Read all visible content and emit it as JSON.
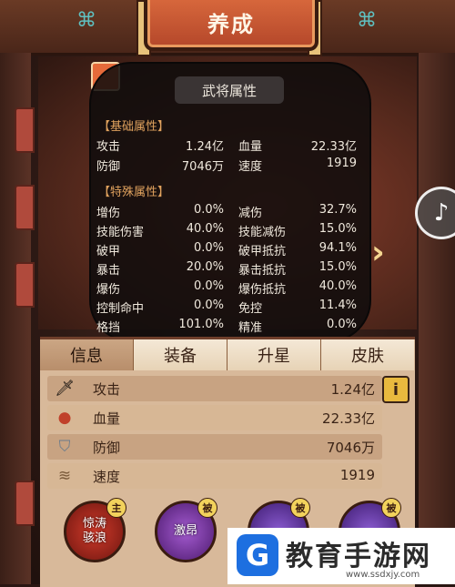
{
  "header": {
    "title": "养成"
  },
  "popup": {
    "title": "武将属性",
    "basic_title": "【基础属性】",
    "basic": [
      {
        "l1": "攻击",
        "v1": "1.24亿",
        "l2": "血量",
        "v2": "22.33亿"
      },
      {
        "l1": "防御",
        "v1": "7046万",
        "l2": "速度",
        "v2": "1919"
      }
    ],
    "special_title": "【特殊属性】",
    "special": [
      {
        "l1": "增伤",
        "v1": "0.0%",
        "l2": "减伤",
        "v2": "32.7%"
      },
      {
        "l1": "技能伤害",
        "v1": "40.0%",
        "l2": "技能减伤",
        "v2": "15.0%"
      },
      {
        "l1": "破甲",
        "v1": "0.0%",
        "l2": "破甲抵抗",
        "v2": "94.1%"
      },
      {
        "l1": "暴击",
        "v1": "20.0%",
        "l2": "暴击抵抗",
        "v2": "15.0%"
      },
      {
        "l1": "爆伤",
        "v1": "0.0%",
        "l2": "爆伤抵抗",
        "v2": "40.0%"
      },
      {
        "l1": "控制命中",
        "v1": "0.0%",
        "l2": "免控",
        "v2": "11.4%"
      },
      {
        "l1": "格挡",
        "v1": "101.0%",
        "l2": "精准",
        "v2": "0.0%"
      }
    ]
  },
  "tabs": [
    "信息",
    "装备",
    "升星",
    "皮肤"
  ],
  "stats": [
    {
      "icon": "sword-icon",
      "label": "攻击",
      "value": "1.24亿"
    },
    {
      "icon": "blood-drop-icon",
      "label": "血量",
      "value": "22.33亿"
    },
    {
      "icon": "shield-icon",
      "label": "防御",
      "value": "7046万"
    },
    {
      "icon": "boot-icon",
      "label": "速度",
      "value": "1919"
    }
  ],
  "info_button": "i",
  "skills": [
    {
      "name": "惊涛\n骇浪",
      "tag": "主"
    },
    {
      "name": "激昂",
      "tag": "被"
    },
    {
      "name": "",
      "tag": "被"
    },
    {
      "name": "",
      "tag": "被"
    }
  ],
  "watermark": {
    "text": "教育手游网",
    "url": "www.ssdxjy.com"
  },
  "colors": {
    "accent": "#c9572f",
    "panel": "#d8b99a",
    "popup_bg": "#141010"
  }
}
